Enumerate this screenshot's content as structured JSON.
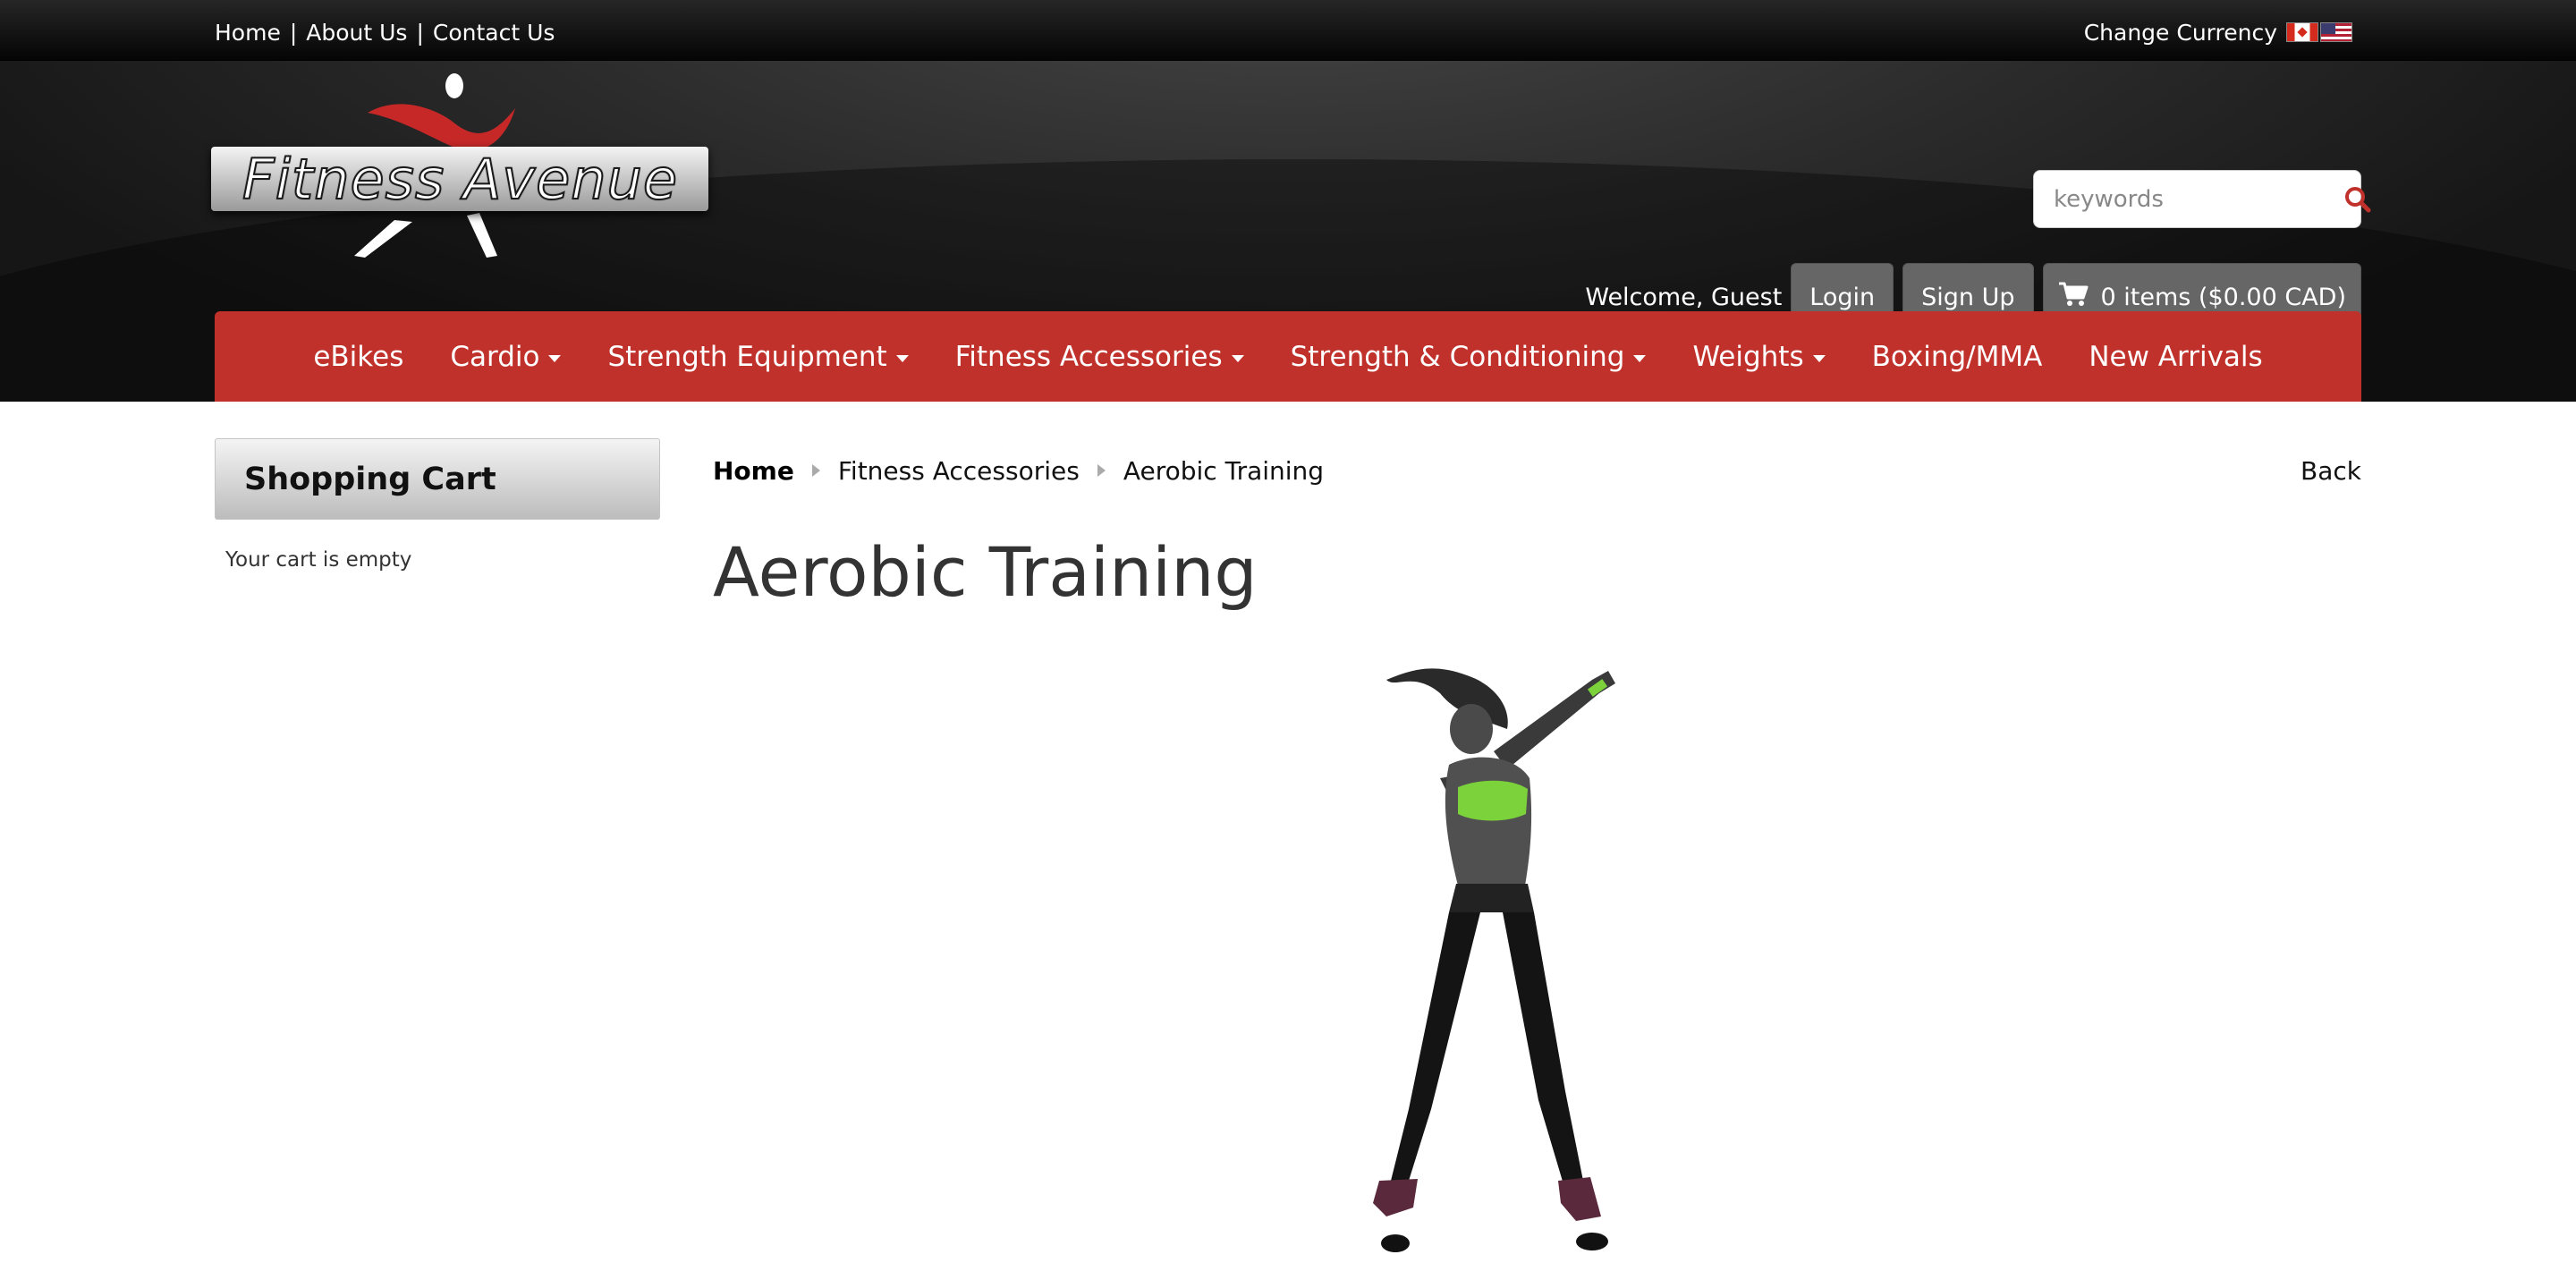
{
  "top_links": [
    {
      "label": "Home"
    },
    {
      "label": "About Us"
    },
    {
      "label": "Contact Us"
    }
  ],
  "top_separator": "|",
  "currency": {
    "label": "Change Currency",
    "flags": [
      "flag-ca-icon",
      "flag-us-icon"
    ]
  },
  "logo": {
    "text": "Fitness Avenue"
  },
  "search": {
    "placeholder": "keywords",
    "value": "",
    "icon": "search-icon"
  },
  "user": {
    "welcome": "Welcome, Guest",
    "login_label": "Login",
    "signup_label": "Sign Up",
    "cart_label": "0 items ($0.00 CAD)",
    "cart_icon": "cart-icon"
  },
  "nav": {
    "items": [
      {
        "label": "eBikes",
        "dropdown": false
      },
      {
        "label": "Cardio",
        "dropdown": true
      },
      {
        "label": "Strength Equipment",
        "dropdown": true
      },
      {
        "label": "Fitness Accessories",
        "dropdown": true
      },
      {
        "label": "Strength & Conditioning",
        "dropdown": true
      },
      {
        "label": "Weights",
        "dropdown": true
      },
      {
        "label": "Boxing/MMA",
        "dropdown": false
      },
      {
        "label": "New Arrivals",
        "dropdown": false
      }
    ]
  },
  "sidebar": {
    "title": "Shopping Cart",
    "empty_text": "Your cart is empty"
  },
  "breadcrumb": {
    "items": [
      "Home",
      "Fitness Accessories",
      "Aerobic Training"
    ]
  },
  "back_label": "Back",
  "page_title": "Aerobic Training",
  "colors": {
    "nav_red": "#c0312b",
    "header_dark": "#1a1a1a",
    "button_gray": "#666666",
    "accent_green": "#7cd23a"
  }
}
